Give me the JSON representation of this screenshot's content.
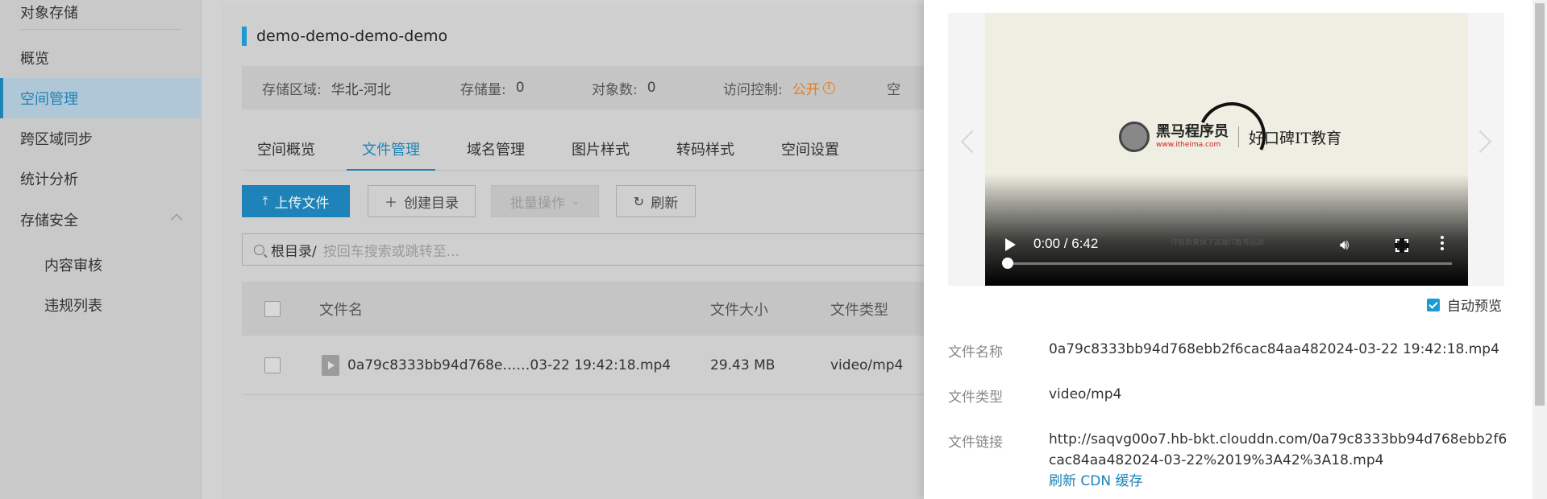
{
  "sidebar": {
    "items": [
      {
        "label": "对象存储"
      },
      {
        "label": "概览"
      },
      {
        "label": "空间管理"
      },
      {
        "label": "跨区域同步"
      },
      {
        "label": "统计分析"
      },
      {
        "label": "存储安全"
      },
      {
        "label": "内容审核"
      },
      {
        "label": "违规列表"
      }
    ]
  },
  "bucket": {
    "name": "demo-demo-demo-demo",
    "info": {
      "region_label": "存储区域:",
      "region_value": "华北-河北",
      "storage_label": "存储量:",
      "storage_value": "0",
      "objects_label": "对象数:",
      "objects_value": "0",
      "access_label": "访问控制:",
      "access_value": "公开",
      "extra_label": "空"
    }
  },
  "tabs": [
    "空间概览",
    "文件管理",
    "域名管理",
    "图片样式",
    "转码样式",
    "空间设置"
  ],
  "toolbar": {
    "upload": "上传文件",
    "mkdir": "创建目录",
    "batch": "批量操作",
    "refresh": "刷新"
  },
  "search": {
    "root": "根目录/",
    "placeholder": "按回车搜索或跳转至..."
  },
  "table": {
    "columns": [
      "文件名",
      "文件大小",
      "文件类型"
    ],
    "rows": [
      {
        "name": "0a79c8333bb94d768e……03-22 19:42:18.mp4",
        "size": "29.43 MB",
        "type": "video/mp4"
      }
    ]
  },
  "drawer": {
    "video": {
      "brand": "黑马程序员",
      "brand_url": "www.itheima.com",
      "slogan": "好口碑IT教育",
      "subtitle": "传智教育旗下高端IT教育品牌",
      "time": "0:00 / 6:42",
      "progress": 0
    },
    "auto_preview": "自动预览",
    "details": {
      "name_label": "文件名称",
      "name_value": "0a79c8333bb94d768ebb2f6cac84aa482024-03-22 19:42:18.mp4",
      "type_label": "文件类型",
      "type_value": "video/mp4",
      "link_label": "文件链接",
      "link_value": "http://saqvg00o7.hb-bkt.clouddn.com/0a79c8333bb94d768ebb2f6cac84aa482024-03-22%2019%3A42%3A18.mp4",
      "refresh_cdn": "刷新 CDN 缓存"
    }
  },
  "colors": {
    "accent": "#1d83b8",
    "warning": "#e77e1e"
  }
}
